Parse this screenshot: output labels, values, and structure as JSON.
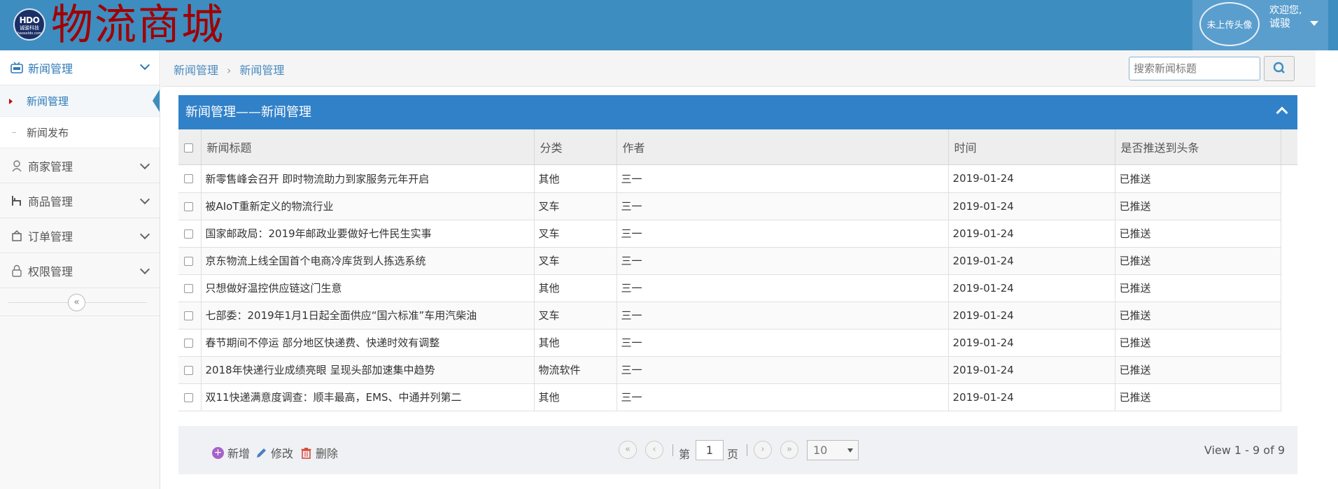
{
  "header": {
    "logo_main": "HDO",
    "logo_sub": "诚骏科技",
    "logo_tiny": "haoseldo.com",
    "title": "物流商城",
    "avatar_text": "未上传头像",
    "welcome": "欢迎您,",
    "username": "诚骏"
  },
  "sidebar": {
    "items": [
      {
        "label": "新闻管理",
        "icon": "tv-icon",
        "expanded": true
      },
      {
        "label": "商家管理",
        "icon": "user-icon"
      },
      {
        "label": "商品管理",
        "icon": "chair-icon"
      },
      {
        "label": "订单管理",
        "icon": "box-icon"
      },
      {
        "label": "权限管理",
        "icon": "lock-icon"
      }
    ],
    "subitems": [
      {
        "label": "新闻管理",
        "active": true
      },
      {
        "label": "新闻发布"
      }
    ],
    "collapse_symbol": "«"
  },
  "breadcrumb": {
    "items": [
      "新闻管理",
      "新闻管理"
    ],
    "sep": "›"
  },
  "search": {
    "placeholder": "搜索新闻标题"
  },
  "panel": {
    "title": "新闻管理——新闻管理"
  },
  "table": {
    "columns": [
      "新闻标题",
      "分类",
      "作者",
      "时间",
      "是否推送到头条"
    ],
    "rows": [
      [
        "新零售峰会召开 即时物流助力到家服务元年开启",
        "其他",
        "三一",
        "2019-01-24",
        "已推送"
      ],
      [
        "被AIoT重新定义的物流行业",
        "叉车",
        "三一",
        "2019-01-24",
        "已推送"
      ],
      [
        "国家邮政局：2019年邮政业要做好七件民生实事",
        "叉车",
        "三一",
        "2019-01-24",
        "已推送"
      ],
      [
        "京东物流上线全国首个电商冷库货到人拣选系统",
        "叉车",
        "三一",
        "2019-01-24",
        "已推送"
      ],
      [
        "只想做好温控供应链这门生意",
        "其他",
        "三一",
        "2019-01-24",
        "已推送"
      ],
      [
        "七部委：2019年1月1日起全面供应“国六标准”车用汽柴油",
        "叉车",
        "三一",
        "2019-01-24",
        "已推送"
      ],
      [
        "春节期间不停运 部分地区快递费、快递时效有调整",
        "其他",
        "三一",
        "2019-01-24",
        "已推送"
      ],
      [
        "2018年快递行业成绩亮眼 呈现头部加速集中趋势",
        "物流软件",
        "三一",
        "2019-01-24",
        "已推送"
      ],
      [
        "双11快递满意度调查：顺丰最高，EMS、中通并列第二",
        "其他",
        "三一",
        "2019-01-24",
        "已推送"
      ]
    ]
  },
  "pager": {
    "add_label": "新增",
    "edit_label": "修改",
    "delete_label": "删除",
    "page_prefix": "第",
    "page_value": "1",
    "page_suffix": "页",
    "page_size": "10",
    "view_info": "View 1 - 9 of 9",
    "first": "«",
    "prev": "‹",
    "next": "›",
    "last": "»"
  },
  "colors": {
    "header_bg": "#3d8dc0",
    "title_red": "#a00000",
    "panel_blue": "#3181c9",
    "link_blue": "#2d7ab8"
  }
}
